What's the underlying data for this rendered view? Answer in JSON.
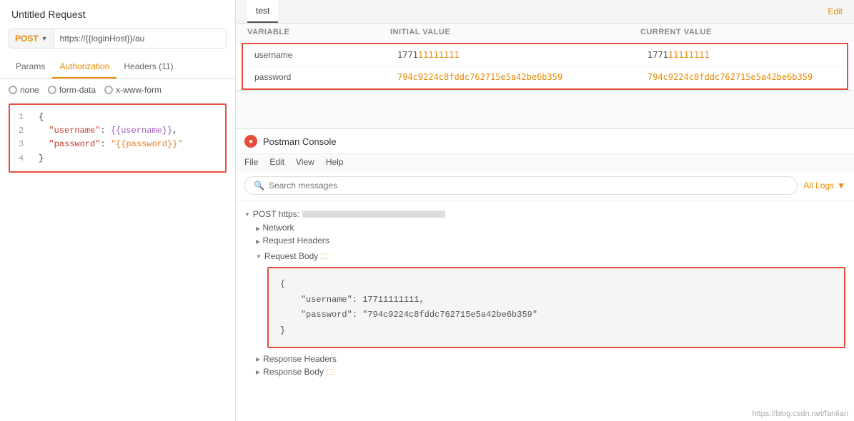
{
  "left": {
    "title": "Untitled Request",
    "method": "POST",
    "url": "https://{{loginHost}}/au",
    "tabs": [
      "Params",
      "Authorization",
      "Headers (11)"
    ],
    "active_tab": "Authorization",
    "body_types": [
      "none",
      "form-data",
      "x-www-form"
    ],
    "code_lines": [
      {
        "num": "1",
        "content": "{",
        "type": "brace"
      },
      {
        "num": "2",
        "content": "\"username\": {{username}},",
        "type": "username"
      },
      {
        "num": "3",
        "content": "\"password\": \"{{password}}\"",
        "type": "password"
      },
      {
        "num": "4",
        "content": "}",
        "type": "brace"
      }
    ]
  },
  "right": {
    "env_tab": "test",
    "edit_label": "Edit",
    "table_headers": {
      "variable": "VARIABLE",
      "initial": "INITIAL VALUE",
      "current": "CURRENT VALUE"
    },
    "env_rows": [
      {
        "variable": "username",
        "initial": "177111111111",
        "current": "177111111111"
      },
      {
        "variable": "password",
        "initial": "794c9224c8fddc762715e5a42be6b359",
        "current": "794c9224c8fddc762715e5a42be6b359"
      }
    ],
    "console": {
      "title": "Postman Console",
      "logo": "●",
      "menu": [
        "File",
        "Edit",
        "View",
        "Help"
      ],
      "search_placeholder": "Search messages",
      "all_logs_label": "All Logs",
      "log_entry": {
        "method": "POST",
        "url_prefix": "https",
        "network": "Network",
        "request_headers": "Request Headers",
        "request_body": "Request Body",
        "request_body_json": {
          "line1": "\"username\": 17711111111,",
          "line2": "\"password\": \"794c9224c8fddc762715e5a42be6b359\""
        },
        "response_headers": "Response Headers",
        "response_body": "Response Body"
      }
    },
    "watermark": "https://blog.csdn.net/fanIian"
  }
}
